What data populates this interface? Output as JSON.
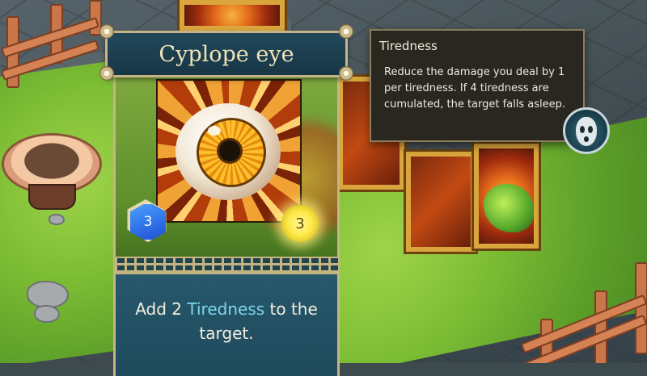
{
  "card": {
    "title": "Cyplope eye",
    "cost": "3",
    "power": "3",
    "description_prefix": "Add 2 ",
    "description_keyword": "Tiredness",
    "description_suffix": " to the target."
  },
  "tooltip": {
    "title": "Tiredness",
    "body": "Reduce the damage you deal by 1 per tiredness. If 4 tiredness are cumulated, the target falls asleep.",
    "status_icon": "sleep-mask-icon"
  },
  "colors": {
    "card_panel": "#1f4a5c",
    "card_border": "#c7b486",
    "keyword": "#7fd6e8",
    "tooltip_bg": "#2a2620",
    "cost_gem": "#1d4fd6",
    "power_glow": "#ffe94a"
  }
}
